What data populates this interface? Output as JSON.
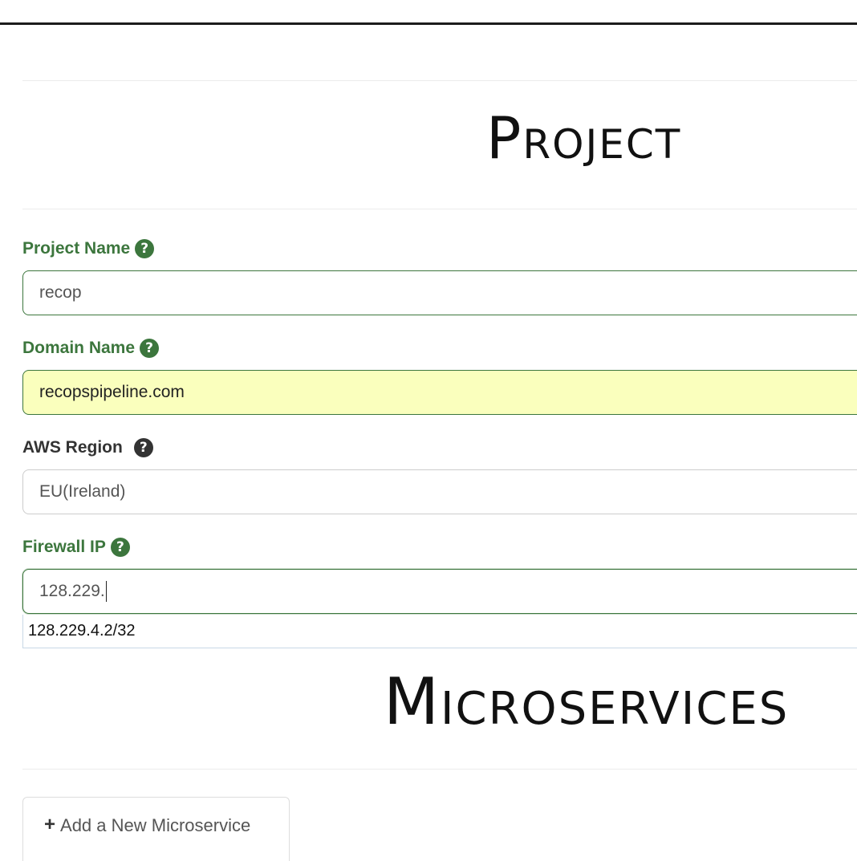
{
  "project_section": {
    "title": "Project"
  },
  "form": {
    "project_name": {
      "label": "Project Name",
      "value": "recop"
    },
    "domain_name": {
      "label": "Domain Name",
      "value": "recopspipeline.com"
    },
    "aws_region": {
      "label": "AWS Region",
      "value": "EU(Ireland)"
    },
    "firewall_ip": {
      "label": "Firewall IP",
      "value": "128.229.",
      "suggestion": "128.229.4.2/32"
    }
  },
  "microservices_section": {
    "title": "Microservices",
    "add_tab_label": "Add a New Microservice"
  },
  "icons": {
    "help": "question-circle-icon",
    "plus": "plus-icon"
  },
  "colors": {
    "success_green": "#3c763d",
    "autofill_yellow": "#faffbd"
  }
}
